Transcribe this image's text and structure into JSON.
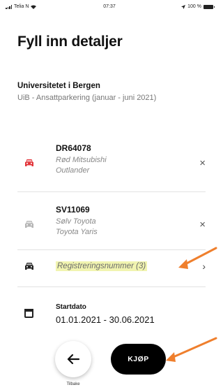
{
  "status_bar": {
    "carrier": "Telia N",
    "time": "07:37",
    "battery": "100 %"
  },
  "page": {
    "title": "Fyll inn detaljer"
  },
  "organization": {
    "name": "Universitetet i Bergen",
    "description": "UiB - Ansattparkering (januar - juni 2021)"
  },
  "vehicles": [
    {
      "plate": "DR64078",
      "description": "Rød Mitsubishi\nOutlander",
      "icon_color": "#e2363b",
      "remove": "×"
    },
    {
      "plate": "SV11069",
      "description": "Sølv Toyota\nToyota Yaris",
      "icon_color": "#b5b5b5",
      "remove": "×"
    }
  ],
  "registration": {
    "label": "Registreringsnummer (3)",
    "chevron": "›"
  },
  "start_date": {
    "label": "Startdato",
    "value": "01.01.2021 - 30.06.2021"
  },
  "actions": {
    "back_label": "Tilbake",
    "buy_label": "KJØP"
  },
  "icons": [
    "car-icon",
    "calendar-icon",
    "back-arrow-icon",
    "close-icon",
    "chevron-right-icon"
  ],
  "colors": {
    "annotation_arrow": "#ef7f2d",
    "highlight": "#f1f4b0",
    "primary": "#000000"
  }
}
